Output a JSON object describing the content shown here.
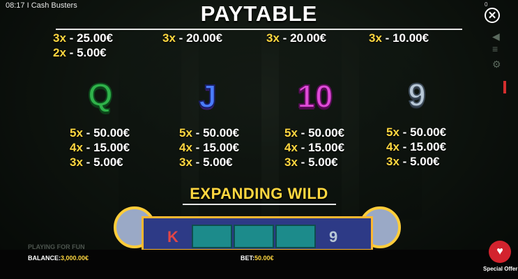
{
  "status_bar": {
    "time_title": "08:17 I Cash Busters",
    "corner_count": "0"
  },
  "title": "PAYTABLE",
  "top_row": [
    {
      "lines": [
        {
          "mult": "3x",
          "amt": "25.00€"
        },
        {
          "mult": "2x",
          "amt": "5.00€"
        }
      ]
    },
    {
      "lines": [
        {
          "mult": "3x",
          "amt": "20.00€"
        }
      ]
    },
    {
      "lines": [
        {
          "mult": "3x",
          "amt": "20.00€"
        }
      ]
    },
    {
      "lines": [
        {
          "mult": "3x",
          "amt": "10.00€"
        }
      ]
    }
  ],
  "symbols": [
    {
      "glyph": "Q",
      "icon": "symbol-q",
      "pays": [
        {
          "mult": "5x",
          "amt": "50.00€"
        },
        {
          "mult": "4x",
          "amt": "15.00€"
        },
        {
          "mult": "3x",
          "amt": "5.00€"
        }
      ]
    },
    {
      "glyph": "J",
      "icon": "symbol-j",
      "pays": [
        {
          "mult": "5x",
          "amt": "50.00€"
        },
        {
          "mult": "4x",
          "amt": "15.00€"
        },
        {
          "mult": "3x",
          "amt": "5.00€"
        }
      ]
    },
    {
      "glyph": "10",
      "icon": "symbol-10",
      "pays": [
        {
          "mult": "5x",
          "amt": "50.00€"
        },
        {
          "mult": "4x",
          "amt": "15.00€"
        },
        {
          "mult": "3x",
          "amt": "5.00€"
        }
      ]
    },
    {
      "glyph": "9",
      "icon": "symbol-9",
      "pays": [
        {
          "mult": "5x",
          "amt": "50.00€"
        },
        {
          "mult": "4x",
          "amt": "15.00€"
        },
        {
          "mult": "3x",
          "amt": "5.00€"
        }
      ]
    }
  ],
  "separator": "-",
  "section_title": "EXPANDING WILD",
  "wild_preview": {
    "left_glyph": "K",
    "right_glyph": "9"
  },
  "footer": {
    "playing_label": "PLAYING FOR FUN",
    "balance_label": "BALANCE:",
    "balance_value": "3,000.00€",
    "bet_label": "BET:",
    "bet_value": "50.00€",
    "special_offer": "Special Offer"
  },
  "icons": {
    "close": "close-icon",
    "special_offer": "heart-icon"
  },
  "colors": {
    "gold": "#ffd740",
    "accent_red": "#d3232e"
  }
}
